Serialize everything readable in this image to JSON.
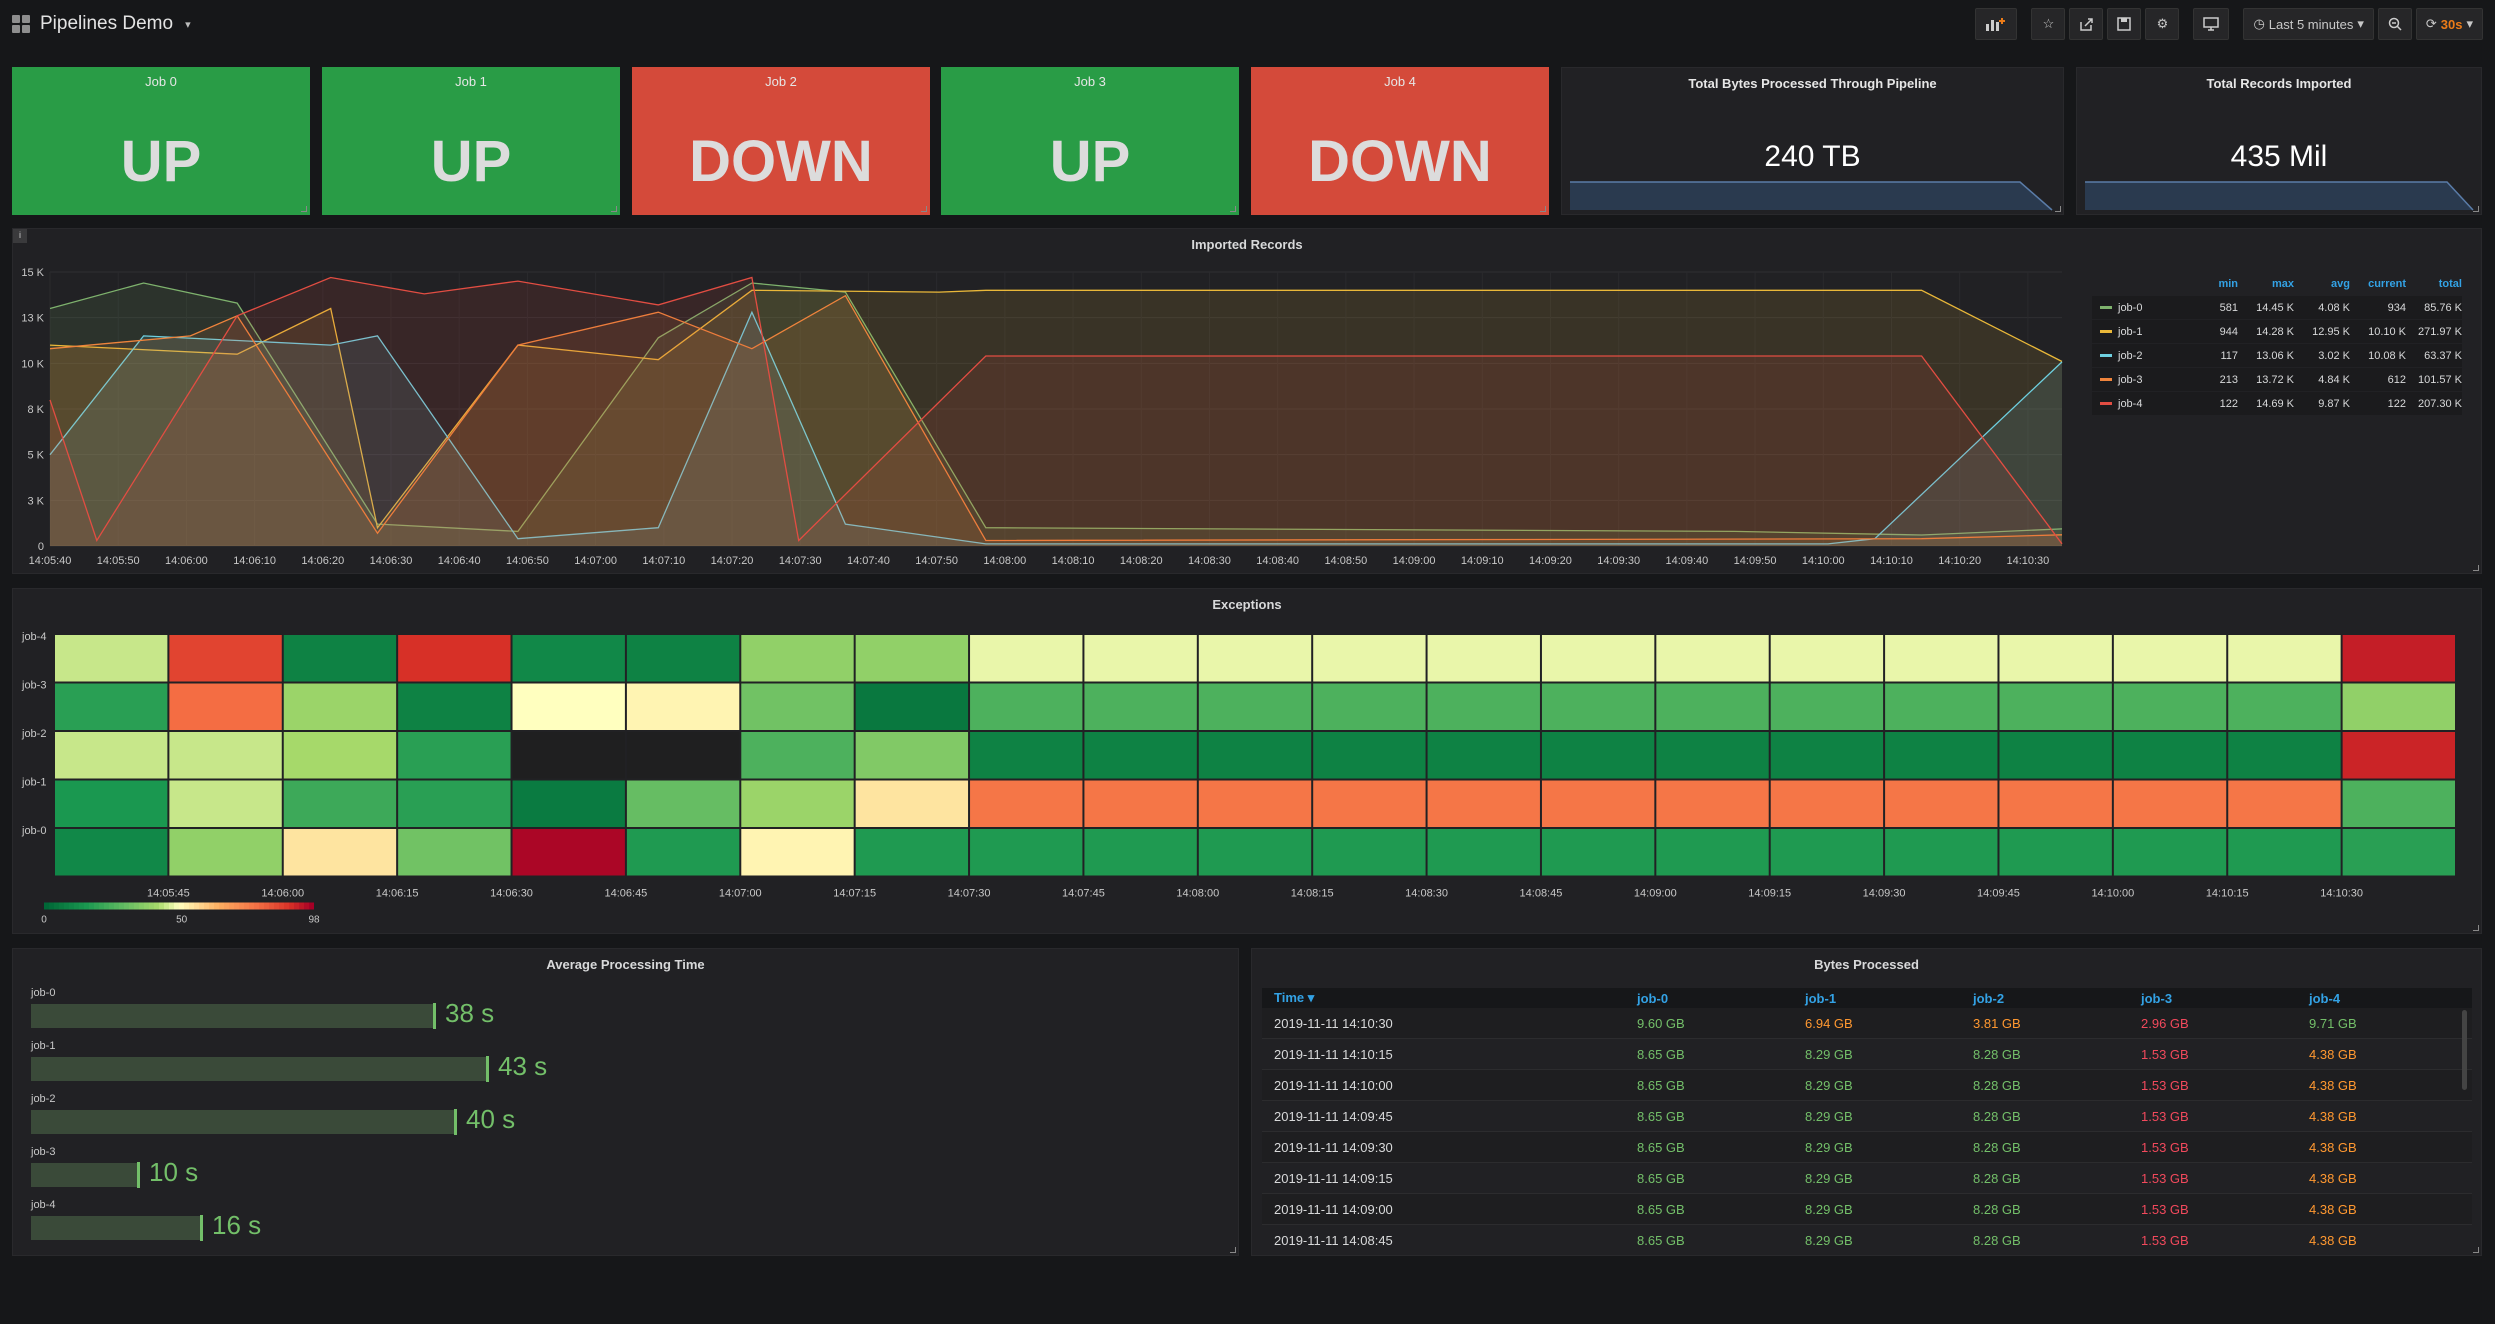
{
  "nav": {
    "title": "Pipelines Demo",
    "time_range": "Last 5 minutes",
    "refresh": "30s"
  },
  "jobs": [
    {
      "title": "Job 0",
      "status": "UP"
    },
    {
      "title": "Job 1",
      "status": "UP"
    },
    {
      "title": "Job 2",
      "status": "DOWN"
    },
    {
      "title": "Job 3",
      "status": "UP"
    },
    {
      "title": "Job 4",
      "status": "DOWN"
    }
  ],
  "stats": {
    "bytes": {
      "title": "Total Bytes Processed Through Pipeline",
      "value": "240 TB"
    },
    "records": {
      "title": "Total Records Imported",
      "value": "435 Mil"
    }
  },
  "colors": {
    "up": "#299c46",
    "down": "#d44a3a",
    "accent": "#eb7b18",
    "link": "#33a2e5"
  },
  "imported": {
    "title": "Imported Records",
    "info": "i",
    "legend_headers": [
      "min",
      "max",
      "avg",
      "current",
      "total"
    ],
    "legend": [
      {
        "name": "job-0",
        "color": "#7eb26d",
        "min": "581",
        "max": "14.45 K",
        "avg": "4.08 K",
        "current": "934",
        "total": "85.76 K"
      },
      {
        "name": "job-1",
        "color": "#eab839",
        "min": "944",
        "max": "14.28 K",
        "avg": "12.95 K",
        "current": "10.10 K",
        "total": "271.97 K"
      },
      {
        "name": "job-2",
        "color": "#6ed0e0",
        "min": "117",
        "max": "13.06 K",
        "avg": "3.02 K",
        "current": "10.08 K",
        "total": "63.37 K"
      },
      {
        "name": "job-3",
        "color": "#ef843c",
        "min": "213",
        "max": "13.72 K",
        "avg": "4.84 K",
        "current": "612",
        "total": "101.57 K"
      },
      {
        "name": "job-4",
        "color": "#e24d42",
        "min": "122",
        "max": "14.69 K",
        "avg": "9.87 K",
        "current": "122",
        "total": "207.30 K"
      }
    ]
  },
  "chart_data": [
    {
      "type": "area",
      "title": "Imported Records",
      "x": [
        "14:05:40",
        "14:05:50",
        "14:06:00",
        "14:06:10",
        "14:06:20",
        "14:06:30",
        "14:06:40",
        "14:06:50",
        "14:07:00",
        "14:07:10",
        "14:07:20",
        "14:07:30",
        "14:07:40",
        "14:07:50",
        "14:08:00",
        "14:08:10",
        "14:08:20",
        "14:08:30",
        "14:08:40",
        "14:08:50",
        "14:09:00",
        "14:09:10",
        "14:09:20",
        "14:09:30",
        "14:09:40",
        "14:09:50",
        "14:10:00",
        "14:10:10",
        "14:10:20",
        "14:10:30"
      ],
      "y_ticks": [
        "0",
        "3 K",
        "5 K",
        "8 K",
        "10 K",
        "13 K",
        "15 K"
      ],
      "ylim": [
        0,
        15000
      ],
      "series": [
        {
          "name": "job-0",
          "points": [
            [
              0,
              13000
            ],
            [
              2,
              14400
            ],
            [
              4,
              13300
            ],
            [
              7,
              1200
            ],
            [
              10,
              800
            ],
            [
              13,
              11400
            ],
            [
              15,
              14400
            ],
            [
              17,
              13900
            ],
            [
              20,
              1000
            ],
            [
              36,
              800
            ],
            [
              40,
              600
            ],
            [
              43,
              934
            ]
          ]
        },
        {
          "name": "job-1",
          "points": [
            [
              0,
              11000
            ],
            [
              4,
              10500
            ],
            [
              6,
              13000
            ],
            [
              7,
              1000
            ],
            [
              10,
              11000
            ],
            [
              13,
              10200
            ],
            [
              15,
              14000
            ],
            [
              19,
              13900
            ],
            [
              20,
              14000
            ],
            [
              40,
              14000
            ],
            [
              43,
              10100
            ]
          ]
        },
        {
          "name": "job-2",
          "points": [
            [
              0,
              5000
            ],
            [
              2,
              11500
            ],
            [
              6,
              11000
            ],
            [
              7,
              11500
            ],
            [
              10,
              400
            ],
            [
              13,
              1000
            ],
            [
              15,
              12800
            ],
            [
              17,
              1200
            ],
            [
              20,
              117
            ],
            [
              38,
              117
            ],
            [
              39,
              400
            ],
            [
              43,
              10080
            ]
          ]
        },
        {
          "name": "job-3",
          "points": [
            [
              0,
              10800
            ],
            [
              3,
              11500
            ],
            [
              4,
              12600
            ],
            [
              7,
              700
            ],
            [
              10,
              11000
            ],
            [
              13,
              12800
            ],
            [
              15,
              10800
            ],
            [
              17,
              13700
            ],
            [
              20,
              300
            ],
            [
              40,
              400
            ],
            [
              43,
              612
            ]
          ]
        },
        {
          "name": "job-4",
          "points": [
            [
              0,
              8000
            ],
            [
              1,
              300
            ],
            [
              4,
              12600
            ],
            [
              6,
              14700
            ],
            [
              8,
              13800
            ],
            [
              10,
              14500
            ],
            [
              13,
              13200
            ],
            [
              15,
              14700
            ],
            [
              16,
              300
            ],
            [
              20,
              10400
            ],
            [
              40,
              10400
            ],
            [
              43,
              122
            ]
          ]
        }
      ]
    },
    {
      "type": "heatmap",
      "title": "Exceptions",
      "y": [
        "job-4",
        "job-3",
        "job-2",
        "job-1",
        "job-0"
      ],
      "x": [
        "14:05:45",
        "14:06:00",
        "14:06:15",
        "14:06:30",
        "14:06:45",
        "14:07:00",
        "14:07:15",
        "14:07:30",
        "14:07:45",
        "14:08:00",
        "14:08:15",
        "14:08:30",
        "14:08:45",
        "14:09:00",
        "14:09:15",
        "14:09:30",
        "14:09:45",
        "14:10:00",
        "14:10:15",
        "14:10:30"
      ],
      "scale": {
        "min": 0,
        "mid": 50,
        "max": 98
      },
      "values": [
        [
          45,
          88,
          8,
          92,
          10,
          8,
          38,
          38,
          48,
          48,
          48,
          48,
          48,
          48,
          48,
          48,
          48,
          48,
          48,
          48,
          95
        ],
        [
          18,
          80,
          40,
          8,
          50,
          52,
          32,
          5,
          25,
          25,
          25,
          25,
          25,
          25,
          25,
          25,
          25,
          25,
          25,
          25,
          38
        ],
        [
          45,
          45,
          42,
          18,
          -1,
          -1,
          25,
          35,
          8,
          8,
          8,
          8,
          8,
          8,
          8,
          8,
          8,
          8,
          8,
          8,
          94
        ],
        [
          15,
          45,
          22,
          18,
          6,
          30,
          40,
          55,
          78,
          78,
          78,
          78,
          78,
          78,
          78,
          78,
          78,
          78,
          78,
          78,
          25
        ],
        [
          10,
          38,
          55,
          32,
          99,
          16,
          52,
          16,
          16,
          16,
          16,
          16,
          16,
          16,
          16,
          16,
          16,
          16,
          16,
          16,
          18
        ]
      ],
      "legend": [
        "0",
        "50",
        "98"
      ]
    },
    {
      "type": "bar",
      "title": "Average Processing Time",
      "categories": [
        "job-0",
        "job-1",
        "job-2",
        "job-3",
        "job-4"
      ],
      "values": [
        38,
        43,
        40,
        10,
        16
      ],
      "display": [
        "38 s",
        "43 s",
        "40 s",
        "10 s",
        "16 s"
      ],
      "unit": "s"
    },
    {
      "type": "table",
      "title": "Bytes Processed",
      "columns": [
        "Time",
        "job-0",
        "job-1",
        "job-2",
        "job-3",
        "job-4"
      ],
      "rows": [
        [
          "2019-11-11 14:10:30",
          "9.60 GB",
          "6.94 GB",
          "3.81 GB",
          "2.96 GB",
          "9.71 GB"
        ],
        [
          "2019-11-11 14:10:15",
          "8.65 GB",
          "8.29 GB",
          "8.28 GB",
          "1.53 GB",
          "4.38 GB"
        ],
        [
          "2019-11-11 14:10:00",
          "8.65 GB",
          "8.29 GB",
          "8.28 GB",
          "1.53 GB",
          "4.38 GB"
        ],
        [
          "2019-11-11 14:09:45",
          "8.65 GB",
          "8.29 GB",
          "8.28 GB",
          "1.53 GB",
          "4.38 GB"
        ],
        [
          "2019-11-11 14:09:30",
          "8.65 GB",
          "8.29 GB",
          "8.28 GB",
          "1.53 GB",
          "4.38 GB"
        ],
        [
          "2019-11-11 14:09:15",
          "8.65 GB",
          "8.29 GB",
          "8.28 GB",
          "1.53 GB",
          "4.38 GB"
        ],
        [
          "2019-11-11 14:09:00",
          "8.65 GB",
          "8.29 GB",
          "8.28 GB",
          "1.53 GB",
          "4.38 GB"
        ],
        [
          "2019-11-11 14:08:45",
          "8.65 GB",
          "8.29 GB",
          "8.28 GB",
          "1.53 GB",
          "4.38 GB"
        ]
      ],
      "cell_colors": [
        [
          "#73bf69",
          "#ff9830",
          "#ff9830",
          "#f2495c",
          "#73bf69"
        ],
        [
          "#73bf69",
          "#73bf69",
          "#73bf69",
          "#f2495c",
          "#ff9830"
        ]
      ]
    }
  ]
}
